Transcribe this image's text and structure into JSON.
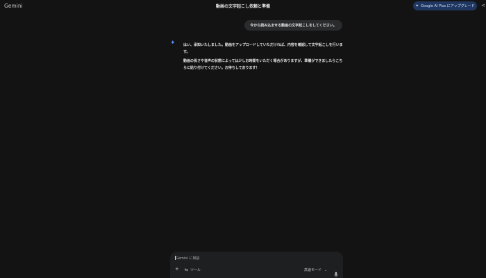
{
  "header": {
    "app_name": "Gemini",
    "chat_title": "動画の文字起こし依頼と準備",
    "upgrade_label": "Google AI Plus にアップグレード"
  },
  "conversation": {
    "user_message": "今から読み込ませる動画の文字起こしをしてください。",
    "response": {
      "paragraph1": "はい、承知いたしました。動画をアップロードしていただければ、内容を確認して文字起こしを行います。",
      "paragraph2": "動画の長さや音声の状態によっては少しお時間をいただく場合がありますが、準備ができましたらこちらに貼り付けてください。お待ちしております！"
    }
  },
  "input": {
    "placeholder": "Gemini に相談",
    "tools_label": "ツール",
    "mode_label": "高速モード"
  },
  "colors": {
    "background": "#131314",
    "bubble": "#2a2b2d",
    "accent": "#5b8ff0",
    "upgrade_button": "#1f3760"
  },
  "icons": {
    "sparkle": "gemini-sparkle-icon",
    "add": "plus-icon",
    "tools": "tools-icon",
    "chevron": "chevron-down-icon",
    "mic": "microphone-icon",
    "share": "share-icon"
  }
}
